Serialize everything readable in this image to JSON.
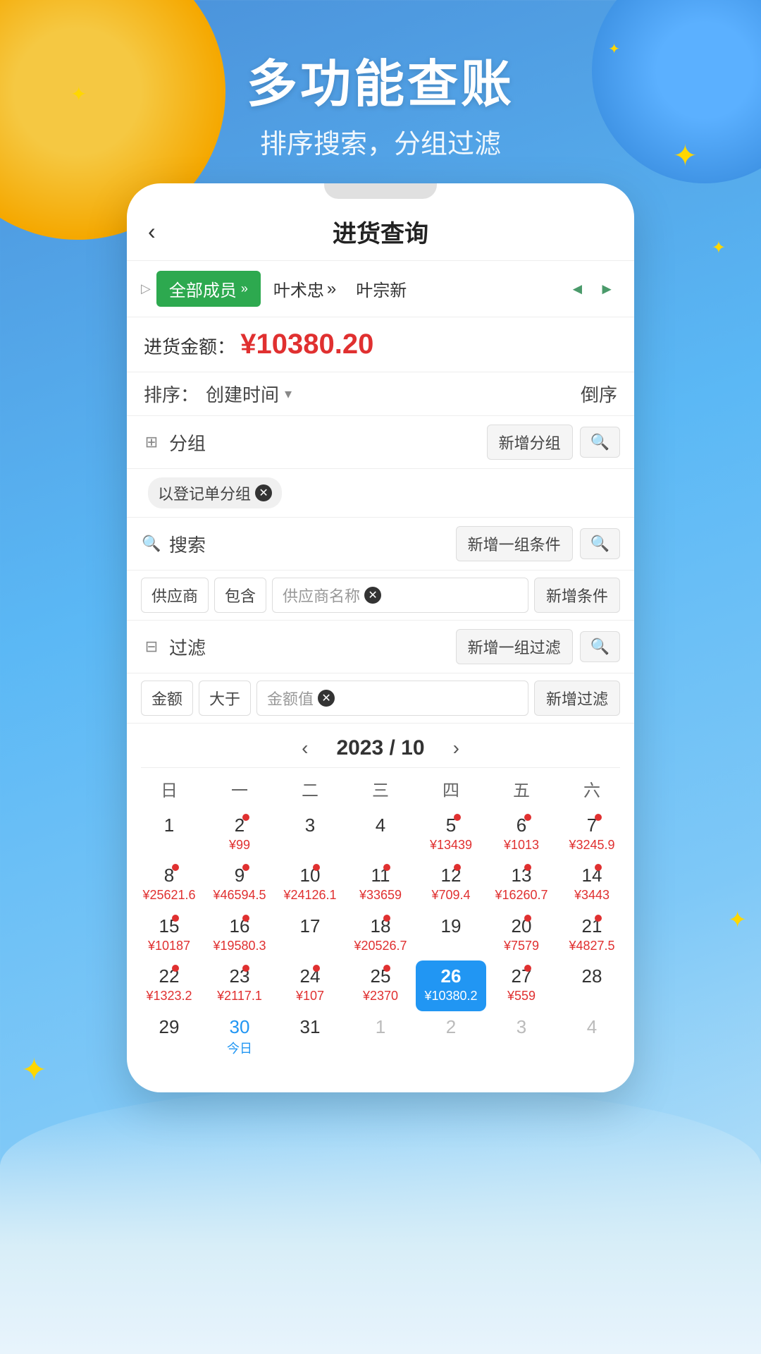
{
  "background": {
    "title_main": "多功能查账",
    "title_sub": "排序搜索，分组过滤"
  },
  "header": {
    "back_label": "‹",
    "title": "进货查询"
  },
  "members": {
    "active": "全部成员",
    "items": [
      "叶术忠",
      "叶宗新"
    ]
  },
  "amount": {
    "label": "进货金额：",
    "value": "¥10380.20"
  },
  "sort": {
    "label": "排序：",
    "field": "创建时间",
    "order": "倒序"
  },
  "group": {
    "icon": "⊞",
    "label": "分组",
    "add_btn": "新增分组",
    "tag": "以登记单分组"
  },
  "search": {
    "icon": "🔍",
    "label": "搜索",
    "add_btn": "新增一组条件",
    "cond_field": "供应商",
    "cond_op": "包含",
    "cond_value": "供应商名称",
    "add_cond": "新增条件"
  },
  "filter": {
    "icon": "⊟",
    "label": "过滤",
    "add_btn": "新增一组过滤",
    "cond_field": "金额",
    "cond_op": "大于",
    "cond_value": "金额值",
    "add_cond": "新增过滤"
  },
  "calendar": {
    "year": "2023",
    "month": "10",
    "display": "2023 / 10",
    "days_of_week": [
      "日",
      "一",
      "二",
      "三",
      "四",
      "五",
      "六"
    ],
    "selected_day": 26,
    "weeks": [
      [
        {
          "day": "1",
          "amount": "",
          "dot": false,
          "gray": false,
          "today": false
        },
        {
          "day": "2",
          "amount": "¥99",
          "dot": true,
          "gray": false,
          "today": false
        },
        {
          "day": "3",
          "amount": "",
          "dot": false,
          "gray": false,
          "today": false
        },
        {
          "day": "4",
          "amount": "",
          "dot": false,
          "gray": false,
          "today": false
        },
        {
          "day": "5",
          "amount": "¥13439",
          "dot": true,
          "gray": false,
          "today": false
        },
        {
          "day": "6",
          "amount": "¥1013",
          "dot": true,
          "gray": false,
          "today": false
        },
        {
          "day": "7",
          "amount": "¥3245.9",
          "dot": true,
          "gray": false,
          "today": false
        }
      ],
      [
        {
          "day": "8",
          "amount": "¥25621.6",
          "dot": true,
          "gray": false,
          "today": false
        },
        {
          "day": "9",
          "amount": "¥46594.5",
          "dot": true,
          "gray": false,
          "today": false
        },
        {
          "day": "10",
          "amount": "¥24126.1",
          "dot": true,
          "gray": false,
          "today": false
        },
        {
          "day": "11",
          "amount": "¥33659",
          "dot": true,
          "gray": false,
          "today": false
        },
        {
          "day": "12",
          "amount": "¥709.4",
          "dot": true,
          "gray": false,
          "today": false
        },
        {
          "day": "13",
          "amount": "¥16260.7",
          "dot": true,
          "gray": false,
          "today": false
        },
        {
          "day": "14",
          "amount": "¥3443",
          "dot": true,
          "gray": false,
          "today": false
        }
      ],
      [
        {
          "day": "15",
          "amount": "¥10187",
          "dot": true,
          "gray": false,
          "today": false
        },
        {
          "day": "16",
          "amount": "¥19580.3",
          "dot": true,
          "gray": false,
          "today": false
        },
        {
          "day": "17",
          "amount": "",
          "dot": false,
          "gray": false,
          "today": false
        },
        {
          "day": "18",
          "amount": "¥20526.7",
          "dot": true,
          "gray": false,
          "today": false
        },
        {
          "day": "19",
          "amount": "",
          "dot": false,
          "gray": false,
          "today": false
        },
        {
          "day": "20",
          "amount": "¥7579",
          "dot": true,
          "gray": false,
          "today": false
        },
        {
          "day": "21",
          "amount": "¥4827.5",
          "dot": true,
          "gray": false,
          "today": false
        }
      ],
      [
        {
          "day": "22",
          "amount": "¥1323.2",
          "dot": true,
          "gray": false,
          "today": false
        },
        {
          "day": "23",
          "amount": "¥2117.1",
          "dot": true,
          "gray": false,
          "today": false
        },
        {
          "day": "24",
          "amount": "¥107",
          "dot": true,
          "gray": false,
          "today": false
        },
        {
          "day": "25",
          "amount": "¥2370",
          "dot": true,
          "gray": false,
          "today": false
        },
        {
          "day": "26",
          "amount": "¥10380.2",
          "dot": true,
          "gray": false,
          "today": false,
          "selected": true
        },
        {
          "day": "27",
          "amount": "¥559",
          "dot": true,
          "gray": false,
          "today": false
        },
        {
          "day": "28",
          "amount": "",
          "dot": false,
          "gray": false,
          "today": false
        }
      ],
      [
        {
          "day": "29",
          "amount": "",
          "dot": false,
          "gray": false,
          "today": false
        },
        {
          "day": "30",
          "amount": "今日",
          "dot": false,
          "gray": false,
          "today": true
        },
        {
          "day": "31",
          "amount": "",
          "dot": false,
          "gray": false,
          "today": false
        },
        {
          "day": "1",
          "amount": "",
          "dot": false,
          "gray": true,
          "today": false
        },
        {
          "day": "2",
          "amount": "",
          "dot": false,
          "gray": true,
          "today": false
        },
        {
          "day": "3",
          "amount": "",
          "dot": false,
          "gray": true,
          "today": false
        },
        {
          "day": "4",
          "amount": "",
          "dot": false,
          "gray": true,
          "today": false
        }
      ]
    ]
  }
}
